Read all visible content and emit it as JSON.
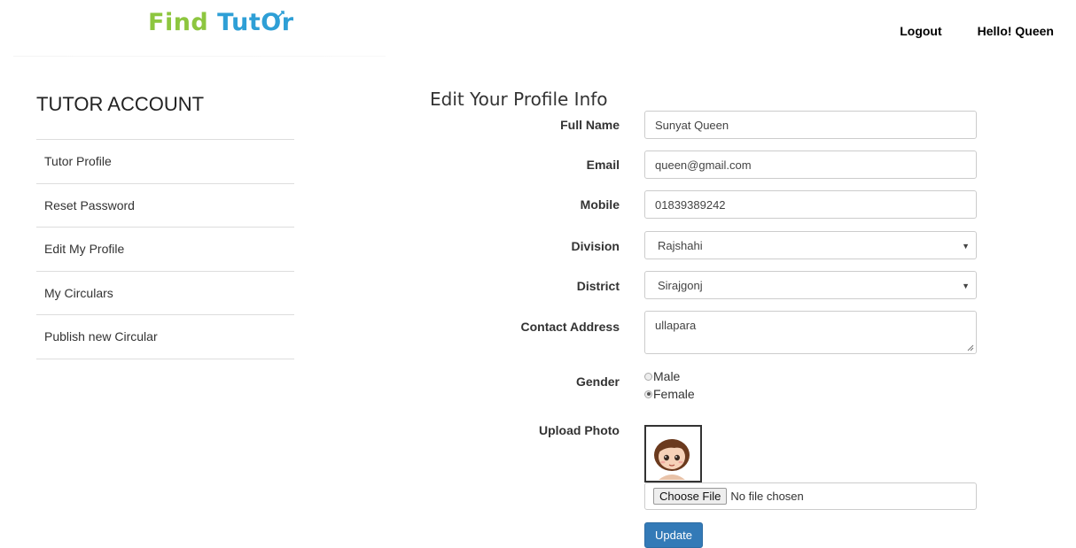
{
  "brand": {
    "word1": "Find",
    "word2": "Tut",
    "word2_end": "r",
    "color1": "#8dc63f",
    "color2": "#2e9fd6"
  },
  "topnav": {
    "logout": "Logout",
    "greeting": "Hello! Queen"
  },
  "sidebar": {
    "title": "TUTOR ACCOUNT",
    "items": [
      {
        "label": "Tutor Profile"
      },
      {
        "label": "Reset Password"
      },
      {
        "label": "Edit My Profile"
      },
      {
        "label": "My Circulars"
      },
      {
        "label": "Publish new Circular"
      }
    ]
  },
  "form": {
    "title": "Edit Your Profile Info",
    "full_name": {
      "label": "Full Name",
      "value": "Sunyat Queen"
    },
    "email": {
      "label": "Email",
      "value": "queen@gmail.com"
    },
    "mobile": {
      "label": "Mobile",
      "value": "01839389242"
    },
    "division": {
      "label": "Division",
      "value": "Rajshahi"
    },
    "district": {
      "label": "District",
      "value": "Sirajgonj"
    },
    "address": {
      "label": "Contact Address",
      "value": "ullapara"
    },
    "gender": {
      "label": "Gender",
      "options": [
        "Male",
        "Female"
      ],
      "selected": "Female"
    },
    "photo": {
      "label": "Upload Photo",
      "choose_label": "Choose File",
      "status": "No file chosen"
    },
    "submit_label": "Update"
  },
  "colors": {
    "primary_button": "#337ab7",
    "border": "#cccccc"
  }
}
